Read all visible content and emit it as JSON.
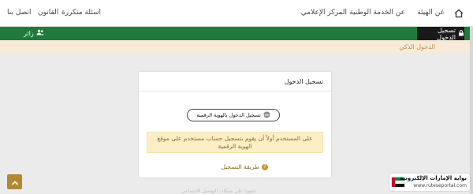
{
  "nav": {
    "items": [
      {
        "label": "عن الهيئة"
      },
      {
        "label": "عن الخدمة الوطنية"
      },
      {
        "label": "المركز الإعلامي"
      },
      {
        "label": "اسئلة متكررة"
      },
      {
        "label": "القانون"
      },
      {
        "label": "اتصل بنا"
      }
    ],
    "home_icon": "home-icon"
  },
  "greenbar": {
    "login_label": "تسجيل الدخول",
    "visitor_label": "زائر"
  },
  "breadcrumb": {
    "current": "الدخول الذكي"
  },
  "login_card": {
    "title": "تسجيل الدخول",
    "uae_pass_button": "تسجيل الدخول بالهوية الرقمية",
    "notice_line1": "على المستخدم أولاً أن يقوم بتسجيل حساب مستخدم على موقع",
    "notice_line2": "الهوية الرقمية",
    "registration_method": "طريقة التسجيل"
  },
  "footer": {
    "social_text": "تابعونا على شبكات التواصل الاجتماعي"
  },
  "watermark": {
    "title": "بوابة الإمارات الإلكترونية",
    "url": "www.ruteseportal.com"
  },
  "colors": {
    "green": "#1f7a3d",
    "gold": "#b58733",
    "notice_bg": "#fcefc7"
  }
}
